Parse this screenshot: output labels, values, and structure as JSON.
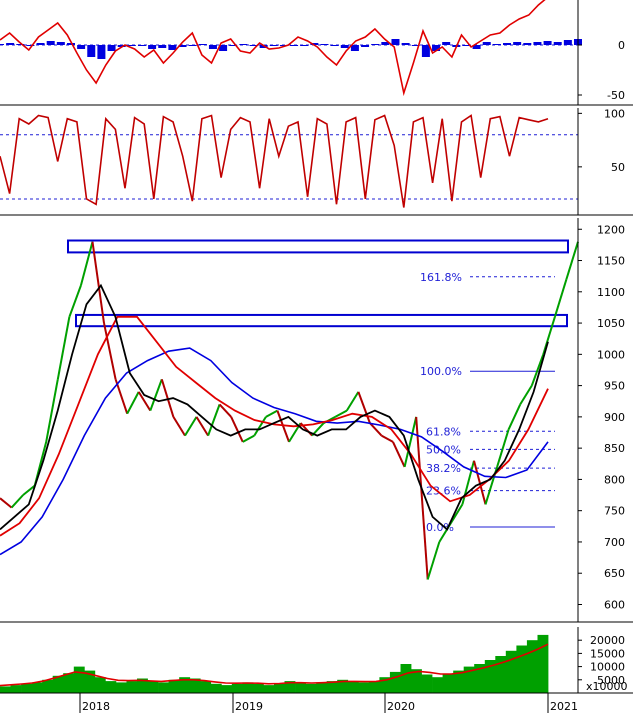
{
  "colors": {
    "price_up": "#00a000",
    "price_down": "#b00000",
    "ma_fast": "#000000",
    "ma_mid": "#e00000",
    "ma_slow": "#0000e0",
    "fib": "#1f1fd6",
    "volume": "#00a000",
    "volume_ma": "#e00000",
    "macd_line": "#e00000",
    "macd_hist": "#0000e0",
    "stoch": "#c00000",
    "panel_border": "#000000"
  },
  "chart_data": [
    {
      "type": "line",
      "panel": "macd",
      "y_ticks": [
        "0",
        "-50"
      ],
      "y_tick_values": [
        0,
        -50
      ],
      "ylim": [
        -60,
        45
      ],
      "zero_line": "dashed",
      "series": [
        {
          "values": [
            5,
            12,
            3,
            -5,
            8,
            15,
            22,
            10,
            -8,
            -25,
            -38,
            -20,
            -6,
            0,
            -4,
            -12,
            -5,
            -18,
            -8,
            3,
            12,
            -10,
            -18,
            2,
            6,
            -6,
            -8,
            2,
            -4,
            -3,
            0,
            8,
            4,
            -2,
            -12,
            -20,
            -6,
            4,
            8,
            16,
            6,
            -2,
            -48,
            -18,
            14,
            -8,
            -2,
            -12,
            10,
            -2,
            4,
            10,
            12,
            20,
            26,
            30,
            40,
            48
          ]
        },
        {
          "values": [
            1,
            2,
            1,
            -1,
            2,
            4,
            3,
            2,
            -4,
            -12,
            -14,
            -6,
            -2,
            0,
            -1,
            -4,
            -3,
            -5,
            -2,
            0,
            1,
            -4,
            -6,
            0,
            1,
            -1,
            -3,
            0,
            -1,
            -1,
            0,
            2,
            1,
            0,
            -3,
            -6,
            -2,
            1,
            3,
            6,
            2,
            0,
            -12,
            -6,
            3,
            -2,
            0,
            -4,
            3,
            1,
            2,
            3,
            2,
            3,
            4,
            3,
            5,
            6
          ]
        }
      ]
    },
    {
      "type": "line",
      "panel": "stochastic",
      "y_ticks": [
        "100",
        "50"
      ],
      "y_tick_values": [
        100,
        50
      ],
      "ylim": [
        5,
        105
      ],
      "ref_lines": [
        80,
        20
      ],
      "series": [
        {
          "values": [
            60,
            25,
            95,
            90,
            98,
            96,
            55,
            95,
            92,
            20,
            15,
            95,
            85,
            30,
            96,
            90,
            20,
            97,
            92,
            60,
            18,
            95,
            98,
            40,
            85,
            96,
            92,
            30,
            95,
            60,
            88,
            92,
            22,
            95,
            90,
            15,
            92,
            96,
            20,
            94,
            98,
            70,
            12,
            92,
            96,
            35,
            95,
            18,
            92,
            98,
            40,
            95,
            97,
            60,
            96,
            94,
            92,
            95
          ]
        }
      ]
    },
    {
      "type": "line",
      "panel": "price",
      "y_ticks": [
        "1200",
        "1150",
        "1100",
        "1050",
        "1000",
        "950",
        "900",
        "850",
        "800",
        "750",
        "700",
        "650",
        "600"
      ],
      "y_tick_values": [
        1200,
        1150,
        1100,
        1050,
        1000,
        950,
        900,
        850,
        800,
        750,
        700,
        650,
        600
      ],
      "ylim": [
        572,
        1218
      ],
      "resistance_zones": [
        [
          1163,
          1182
        ],
        [
          1045,
          1063
        ]
      ],
      "fibonacci": [
        {
          "label": "161.8%",
          "value": 1124
        },
        {
          "label": "100.0%",
          "value": 973
        },
        {
          "label": "61.8%",
          "value": 877
        },
        {
          "label": "50.0%",
          "value": 848
        },
        {
          "label": "38.2%",
          "value": 818
        },
        {
          "label": "23.6%",
          "value": 782
        },
        {
          "label": "0.0%",
          "value": 724
        }
      ],
      "series": [
        {
          "values": [
            770,
            755,
            775,
            790,
            860,
            960,
            1060,
            1110,
            1180,
            1050,
            960,
            905,
            940,
            910,
            960,
            900,
            870,
            900,
            870,
            920,
            900,
            860,
            870,
            900,
            910,
            860,
            890,
            870,
            890,
            900,
            910,
            940,
            890,
            870,
            860,
            820,
            900,
            640,
            700,
            730,
            760,
            830,
            760,
            820,
            880,
            920,
            950,
            1000,
            1060,
            1120,
            1180
          ]
        },
        {
          "values": [
            720,
            740,
            760,
            830,
            910,
            1000,
            1080,
            1110,
            1060,
            970,
            935,
            925,
            930,
            920,
            900,
            880,
            870,
            880,
            880,
            890,
            900,
            880,
            870,
            880,
            880,
            900,
            910,
            900,
            870,
            800,
            740,
            720,
            770,
            790,
            800,
            830,
            880,
            940,
            1020
          ]
        },
        {
          "values": [
            710,
            730,
            770,
            840,
            920,
            1000,
            1060,
            1060,
            1020,
            980,
            955,
            930,
            910,
            895,
            888,
            885,
            888,
            895,
            905,
            900,
            880,
            840,
            790,
            765,
            775,
            800,
            830,
            880,
            945
          ]
        },
        {
          "values": [
            680,
            700,
            740,
            800,
            870,
            930,
            970,
            990,
            1005,
            1010,
            990,
            955,
            930,
            915,
            905,
            893,
            890,
            893,
            887,
            880,
            868,
            845,
            820,
            805,
            803,
            815,
            860
          ]
        }
      ]
    },
    {
      "type": "bar",
      "panel": "volume",
      "y_ticks": [
        "20000",
        "15000",
        "10000",
        "5000"
      ],
      "y_tick_values": [
        20000,
        15000,
        10000,
        5000
      ],
      "ylim": [
        0,
        25000
      ],
      "unit_label": "x10000",
      "x_ticks": [
        "2018",
        "2019",
        "2020",
        "2021"
      ],
      "values": [
        2500,
        3000,
        3500,
        4000,
        5000,
        6500,
        7500,
        10000,
        8500,
        6000,
        4500,
        4000,
        4500,
        5500,
        4500,
        4000,
        5000,
        6000,
        5500,
        4500,
        3500,
        3000,
        3500,
        4000,
        3500,
        3000,
        3500,
        4500,
        4000,
        3500,
        4000,
        4500,
        5000,
        4500,
        4000,
        4500,
        6000,
        8000,
        11000,
        9000,
        7000,
        6000,
        7000,
        8500,
        10000,
        11000,
        12500,
        14000,
        16000,
        18000,
        20000,
        22000
      ],
      "ma_values": [
        2800,
        3100,
        3400,
        3800,
        4500,
        5600,
        6800,
        8000,
        7500,
        6500,
        5500,
        4800,
        4700,
        4800,
        4600,
        4400,
        4700,
        5000,
        5000,
        4700,
        4200,
        3800,
        3700,
        3800,
        3700,
        3500,
        3600,
        3900,
        3900,
        3800,
        3900,
        4100,
        4400,
        4400,
        4300,
        4400,
        5000,
        6200,
        7600,
        8200,
        7800,
        7200,
        7200,
        7700,
        8600,
        9500,
        10600,
        11800,
        13300,
        14800,
        16500,
        18500
      ]
    }
  ]
}
